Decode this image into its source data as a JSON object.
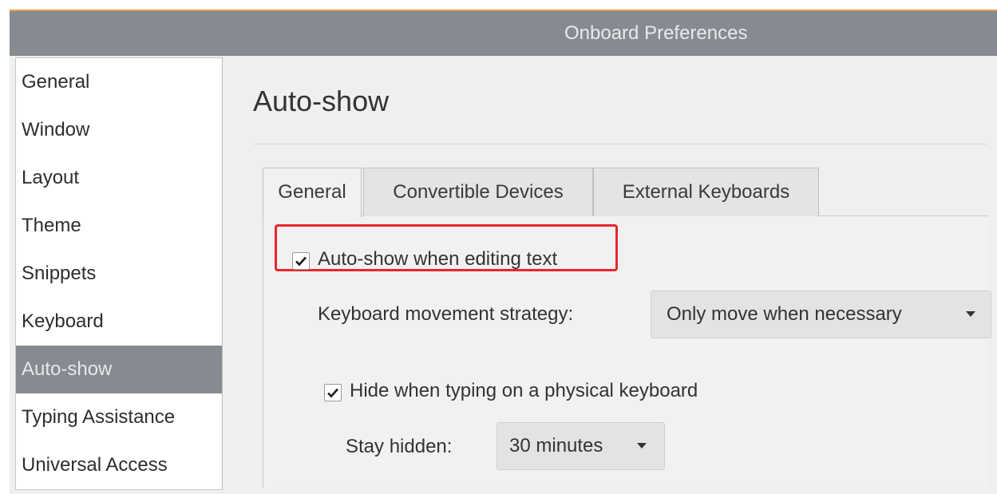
{
  "window": {
    "title": "Onboard Preferences"
  },
  "sidebar": {
    "items": [
      {
        "label": "General"
      },
      {
        "label": "Window"
      },
      {
        "label": "Layout"
      },
      {
        "label": "Theme"
      },
      {
        "label": "Snippets"
      },
      {
        "label": "Keyboard"
      },
      {
        "label": "Auto-show",
        "selected": true
      },
      {
        "label": "Typing Assistance"
      },
      {
        "label": "Universal Access"
      }
    ]
  },
  "page": {
    "title": "Auto-show"
  },
  "tabs": [
    {
      "label": "General",
      "active": true
    },
    {
      "label": "Convertible Devices"
    },
    {
      "label": "External Keyboards"
    }
  ],
  "general_tab": {
    "auto_show": {
      "label": "Auto-show when editing text",
      "checked": true
    },
    "movement_strategy": {
      "label": "Keyboard movement strategy:",
      "value": "Only move when necessary"
    },
    "hide_when_typing": {
      "label": "Hide when typing on a physical keyboard",
      "checked": true
    },
    "stay_hidden": {
      "label": "Stay hidden:",
      "value": "30 minutes"
    }
  },
  "colors": {
    "titlebar": "#868b91",
    "selection": "#868b91",
    "highlight_box": "#e8262a",
    "accent_strip": "#e59a45"
  },
  "icons": [
    "check-icon",
    "dropdown-arrow-icon"
  ]
}
